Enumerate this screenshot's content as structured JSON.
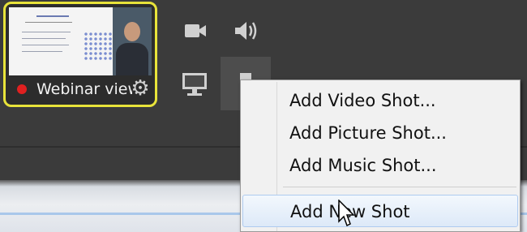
{
  "shot_tile": {
    "name": "Webinar view",
    "highlight_color": "#e8e33a",
    "recording_color": "#e02020"
  },
  "toolbar": {
    "icons": [
      "camera-icon",
      "speaker-icon",
      "monitor-icon",
      "paper-icon"
    ]
  },
  "context_menu": {
    "items": [
      {
        "label": "Add Video Shot..."
      },
      {
        "label": "Add Picture Shot..."
      },
      {
        "label": "Add Music Shot..."
      },
      {
        "label": "Add New Shot",
        "hovered": true
      }
    ]
  }
}
